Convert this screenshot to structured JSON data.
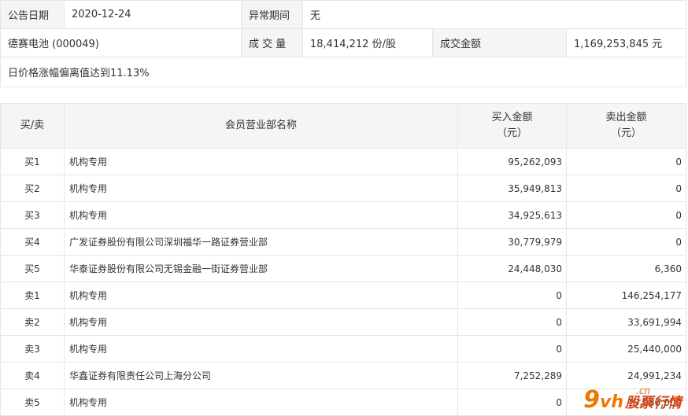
{
  "info": {
    "announce_date_label": "公告日期",
    "announce_date_value": "2020-12-24",
    "abnormal_period_label": "异常期间",
    "abnormal_period_value": "无",
    "stock": "德赛电池 (000049)",
    "volume_label": "成 交 量",
    "volume_value": "18,414,212 份/股",
    "amount_label": "成交金额",
    "amount_value": "1,169,253,845 元",
    "reason": "日价格涨幅偏离值达到11.13%"
  },
  "trade_table": {
    "headers": {
      "side": "买/卖",
      "member": "会员营业部名称",
      "buy_line1": "买入金额",
      "buy_line2": "（元）",
      "sell_line1": "卖出金额",
      "sell_line2": "（元）"
    },
    "rows": [
      {
        "side": "买1",
        "name": "机构专用",
        "buy": "95,262,093",
        "sell": "0"
      },
      {
        "side": "买2",
        "name": "机构专用",
        "buy": "35,949,813",
        "sell": "0"
      },
      {
        "side": "买3",
        "name": "机构专用",
        "buy": "34,925,613",
        "sell": "0"
      },
      {
        "side": "买4",
        "name": "广发证券股份有限公司深圳福华一路证券营业部",
        "buy": "30,779,979",
        "sell": "0"
      },
      {
        "side": "买5",
        "name": "华泰证券股份有限公司无锡金融一街证券营业部",
        "buy": "24,448,030",
        "sell": "6,360"
      },
      {
        "side": "卖1",
        "name": "机构专用",
        "buy": "0",
        "sell": "146,254,177"
      },
      {
        "side": "卖2",
        "name": "机构专用",
        "buy": "0",
        "sell": "33,691,994"
      },
      {
        "side": "卖3",
        "name": "机构专用",
        "buy": "0",
        "sell": "25,440,000"
      },
      {
        "side": "卖4",
        "name": "华鑫证券有限责任公司上海分公司",
        "buy": "7,252,289",
        "sell": "24,991,234"
      },
      {
        "side": "卖5",
        "name": "机构专用",
        "buy": "0",
        "sell": "19,080,000"
      }
    ]
  },
  "watermark": {
    "nine": "9",
    "vh": "vh",
    "cn": ".cn",
    "cn_text": "股票行情",
    "color": "#ee7700"
  }
}
